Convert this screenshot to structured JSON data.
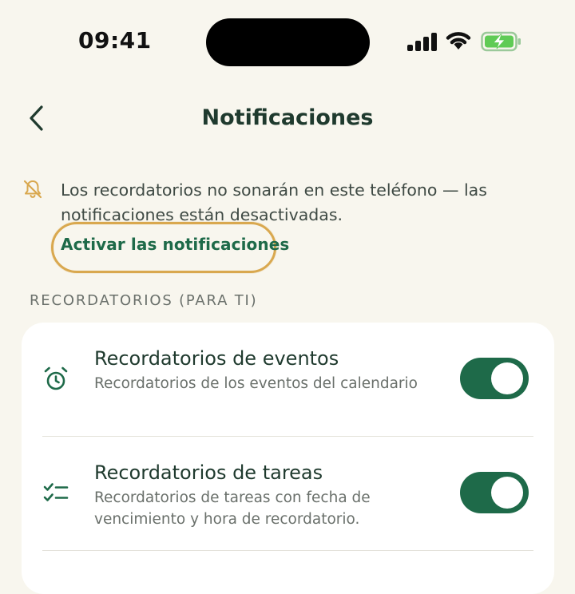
{
  "status_bar": {
    "time": "09:41"
  },
  "header": {
    "title": "Notificaciones"
  },
  "banner": {
    "message": "Los recordatorios no sonarán en este teléfono — las notificaciones están desactivadas.",
    "action_label": "Activar las notificaciones"
  },
  "section": {
    "label": "RECORDATORIOS (PARA TI)"
  },
  "settings": [
    {
      "title": "Recordatorios de eventos",
      "subtitle": "Recordatorios de los eventos del calendario",
      "icon": "alarm-clock-icon",
      "enabled": true
    },
    {
      "title": "Recordatorios de tareas",
      "subtitle": "Recordatorios de tareas con fecha de vencimiento y hora de recordatorio.",
      "icon": "checklist-icon",
      "enabled": true
    }
  ],
  "colors": {
    "background": "#F8F6EE",
    "accent": "#1E6A49",
    "highlight": "#D9A84F",
    "warning_icon": "#D9A84F",
    "battery_fill": "#5FCB55"
  }
}
